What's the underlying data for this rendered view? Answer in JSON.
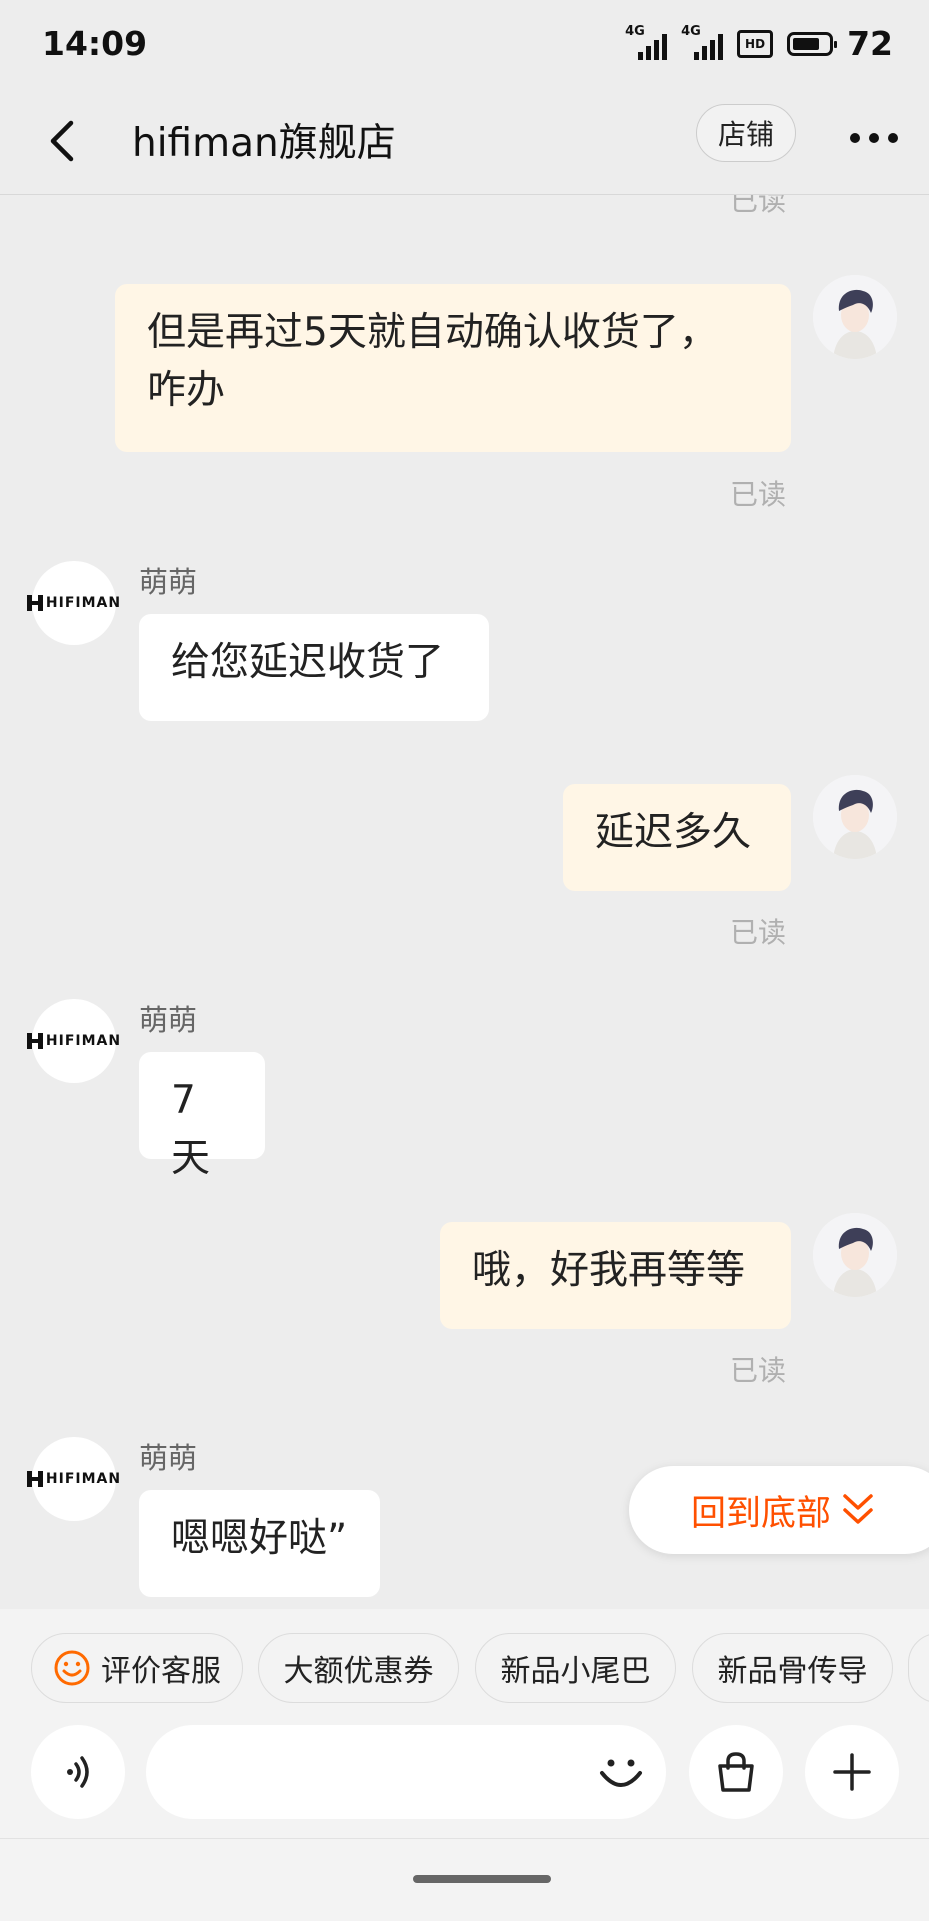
{
  "status_bar": {
    "time": "14:09",
    "signal1_label": "4G",
    "signal2_label": "4G",
    "hd_label": "HD",
    "battery": "72"
  },
  "header": {
    "title": "hifiman旗舰店",
    "shop_button": "店铺"
  },
  "chat": {
    "read_label": "已读",
    "messages": [
      {
        "from": "me",
        "text": "但是再过5天就自动确认收货了，咋办",
        "line1": "但是再过5天就自动确认收货了，",
        "line2": "咋办"
      },
      {
        "from": "shop",
        "sender": "萌萌",
        "text": "给您延迟收货了"
      },
      {
        "from": "me",
        "text": "延迟多久"
      },
      {
        "from": "shop",
        "sender": "萌萌",
        "text": "7天"
      },
      {
        "from": "me",
        "text": "哦，好我再等等"
      },
      {
        "from": "shop",
        "sender": "萌萌",
        "text": "嗯嗯好哒”"
      }
    ]
  },
  "shop_logo_text": "HIFIMAN",
  "back_to_bottom": "回到底部",
  "quick_chips": [
    {
      "label": "评价客服",
      "icon": "smiley-icon"
    },
    {
      "label": "大额优惠券"
    },
    {
      "label": "新品小尾巴"
    },
    {
      "label": "新品骨传导"
    }
  ],
  "input_bar": {
    "voice_icon": "voice-icon",
    "emoji_icon": "emoji-icon",
    "bag_icon": "shopping-bag-icon",
    "plus_icon": "plus-icon"
  },
  "colors": {
    "accent": "#ff5000",
    "my_bubble": "#fff6e6",
    "their_bubble": "#ffffff",
    "background": "#ededed"
  }
}
